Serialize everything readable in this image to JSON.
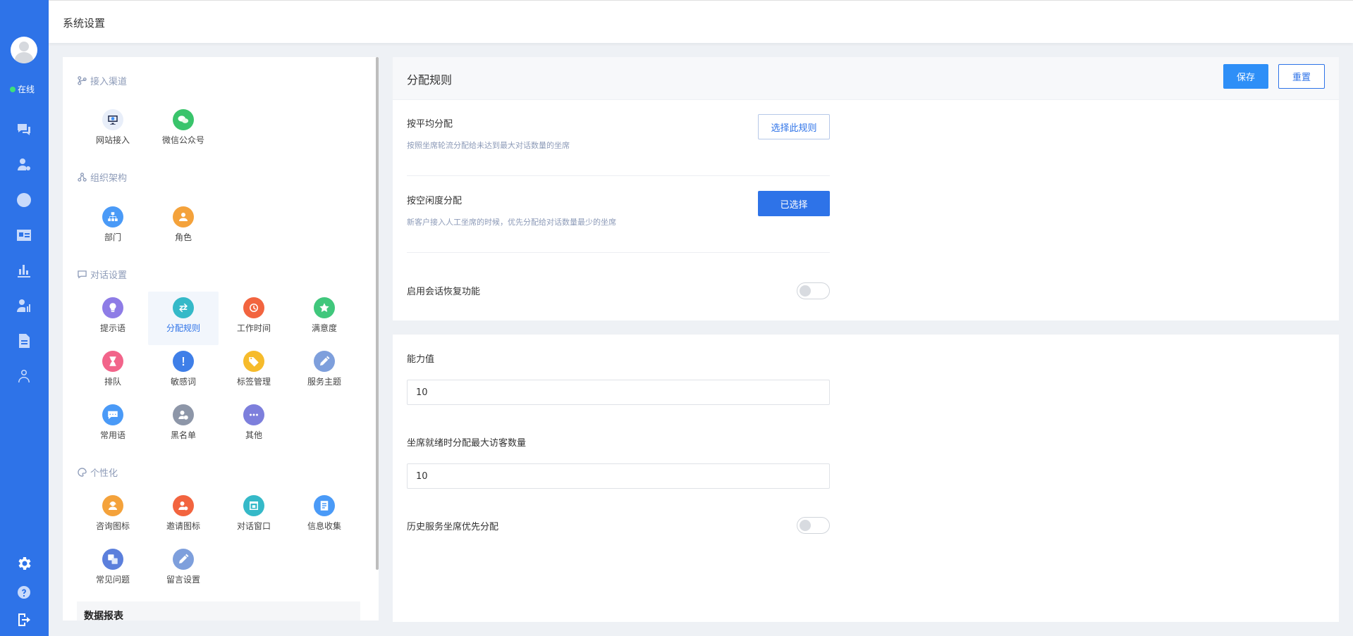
{
  "topbar": {
    "title": "系统设置"
  },
  "sidebar": {
    "status": "在线",
    "nav": [
      "chat-icon",
      "user-settings-icon",
      "clock-icon",
      "contact-card-icon",
      "bar-chart-icon",
      "agent-icon",
      "document-icon",
      "customer-icon"
    ],
    "bottom": [
      "gear-icon",
      "help-icon",
      "logout-icon"
    ]
  },
  "left_panel": {
    "sections": {
      "access": {
        "title": "接入渠道",
        "items": [
          "网站接入",
          "微信公众号"
        ]
      },
      "org": {
        "title": "组织架构",
        "items": [
          "部门",
          "角色"
        ]
      },
      "dialog": {
        "title": "对话设置",
        "items": [
          "提示语",
          "分配规则",
          "工作时间",
          "满意度",
          "排队",
          "敏感词",
          "标签管理",
          "服务主题",
          "常用语",
          "黑名单",
          "其他"
        ]
      },
      "personal": {
        "title": "个性化",
        "items": [
          "咨询图标",
          "邀请图标",
          "对话窗口",
          "信息收集",
          "常见问题",
          "留言设置"
        ]
      }
    },
    "data_report": "数据报表"
  },
  "card1": {
    "title": "分配规则",
    "save": "保存",
    "reset": "重置",
    "rules": [
      {
        "title": "按平均分配",
        "desc": "按照坐席轮流分配给未达到最大对话数量的坐席",
        "button": "选择此规则",
        "selected": false
      },
      {
        "title": "按空闲度分配",
        "desc": "新客户接入人工坐席的时候，优先分配给对话数量最少的坐席",
        "button": "已选择",
        "selected": true
      }
    ],
    "restore_label": "启用会话恢复功能",
    "restore_on": false
  },
  "card2": {
    "capacity_label": "能力值",
    "capacity_value": "10",
    "max_visitors_label": "坐席就绪时分配最大访客数量",
    "max_visitors_value": "10",
    "history_label": "历史服务坐席优先分配",
    "history_on": false
  },
  "colors": {
    "primary": "#2e73e8",
    "save": "#2e8ff7",
    "online": "#3ee07a"
  }
}
